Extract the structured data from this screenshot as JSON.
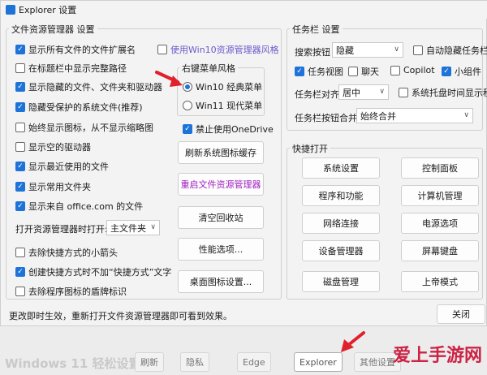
{
  "window": {
    "title": "Explorer 设置"
  },
  "explorer": {
    "group_title": "文件资源管理器 设置",
    "options": [
      {
        "label": "显示所有文件的文件扩展名",
        "checked": true
      },
      {
        "label": "在标题栏中显示完整路径",
        "checked": false
      },
      {
        "label": "显示隐藏的文件、文件夹和驱动器",
        "checked": true
      },
      {
        "label": "隐藏受保护的系统文件(推荐)",
        "checked": true
      },
      {
        "label": "始终显示图标，从不显示缩略图",
        "checked": false
      },
      {
        "label": "显示空的驱动器",
        "checked": false
      },
      {
        "label": "显示最近使用的文件",
        "checked": true
      },
      {
        "label": "显示常用文件夹",
        "checked": true
      },
      {
        "label": "显示来自 office.com 的文件",
        "checked": true
      }
    ],
    "win10_explorer_style": {
      "label": "使用Win10资源管理器风格",
      "checked": false
    },
    "open_to_label": "打开资源管理器时打开:",
    "open_to_value": "主文件夹",
    "bottom_options": [
      {
        "label": "去除快捷方式的小箭头",
        "checked": false
      },
      {
        "label": "创建快捷方式时不加“快捷方式”文字",
        "checked": true
      },
      {
        "label": "去除程序图标的盾牌标识",
        "checked": false
      }
    ],
    "context_menu_title": "右键菜单风格",
    "radio_win10": "Win10 经典菜单",
    "radio_win11": "Win11 现代菜单",
    "disable_onedrive": {
      "label": "禁止使用OneDrive",
      "checked": true
    },
    "buttons": {
      "refresh_icon_cache": "刷新系统图标缓存",
      "restart_explorer": "重启文件资源管理器",
      "empty_recycle": "清空回收站",
      "perf_options": "性能选项...",
      "desktop_icons": "桌面图标设置..."
    }
  },
  "taskbar": {
    "group_title": "任务栏 设置",
    "search_label": "搜索按钮",
    "search_value": "隐藏",
    "auto_hide": {
      "label": "自动隐藏任务栏",
      "checked": false
    },
    "items": [
      {
        "label": "任务视图",
        "checked": true
      },
      {
        "label": "聊天",
        "checked": false
      },
      {
        "label": "Copilot",
        "checked": false
      },
      {
        "label": "小组件",
        "checked": true
      }
    ],
    "align_label": "任务栏对齐",
    "align_value": "居中",
    "show_seconds": {
      "label": "系统托盘时间显示秒",
      "checked": false
    },
    "merge_label": "任务栏按钮合并",
    "merge_value": "始终合并"
  },
  "quick_open": {
    "group_title": "快捷打开",
    "buttons": [
      "系统设置",
      "控制面板",
      "程序和功能",
      "计算机管理",
      "网络连接",
      "电源选项",
      "设备管理器",
      "屏幕键盘",
      "磁盘管理",
      "上帝模式"
    ]
  },
  "footer": {
    "status": "更改即时生效，重新打开文件资源管理器即可看到效果。",
    "close": "关闭"
  },
  "background_bar": {
    "title": "Windows 11 轻松设置",
    "items": [
      "刷新",
      "隐私",
      "Edge",
      "Explorer",
      "其他设置"
    ]
  },
  "watermark": "爱上手游网",
  "colors": {
    "accent": "#1e73d8",
    "arrow": "#e0202a",
    "link": "#6a5acd",
    "restart": "#a020c0"
  }
}
